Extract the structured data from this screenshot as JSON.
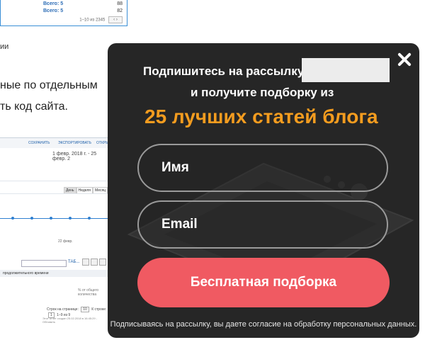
{
  "background_page": {
    "table": {
      "rows": [
        {
          "link": "Всего: 5",
          "value": "88"
        },
        {
          "link": "Всего: 5",
          "value": "82"
        }
      ],
      "pager_text": "1–10 из 2345"
    },
    "small_text": "ии",
    "body_lines": [
      "ные по отдельным",
      "ть код сайта."
    ],
    "screenshot": {
      "toolbar": [
        "СОХРАНИТЬ",
        "ЭКСПОРТИРОВАТЬ",
        "ОТКРЫТЬ"
      ],
      "date_range": "1 февр. 2018 г. - 25 февр. 2",
      "segments": [
        "День",
        "Неделя",
        "Месяц"
      ],
      "tick_label": "22 февр.",
      "search_button": "ТАБ...",
      "column_header": "продолжительного времени",
      "note": "% от общего количества",
      "rows_per_page_label": "Строк на странице:",
      "rows_per_page_value": "10",
      "goto_label": "К строке:",
      "goto_value": "1",
      "range_text": "1–9 из 9",
      "footer_text": "Этот отчет создан 25.02.2018 в 16:45:29 - Обновить"
    }
  },
  "popup": {
    "headline_line1": "Подпишитесь на рассылку",
    "headline_line2": "и получите подборку из",
    "headline_accent": "25 лучших статей блога",
    "name_placeholder": "Имя",
    "email_placeholder": "Email",
    "submit_label": "Бесплатная подборка",
    "consent_text": "Подписываясь на рассылку, вы даете согласие на обработку персональных данных.",
    "accent_color": "#f39c1f",
    "button_color": "#f05a62",
    "close_icon": "close-icon"
  }
}
